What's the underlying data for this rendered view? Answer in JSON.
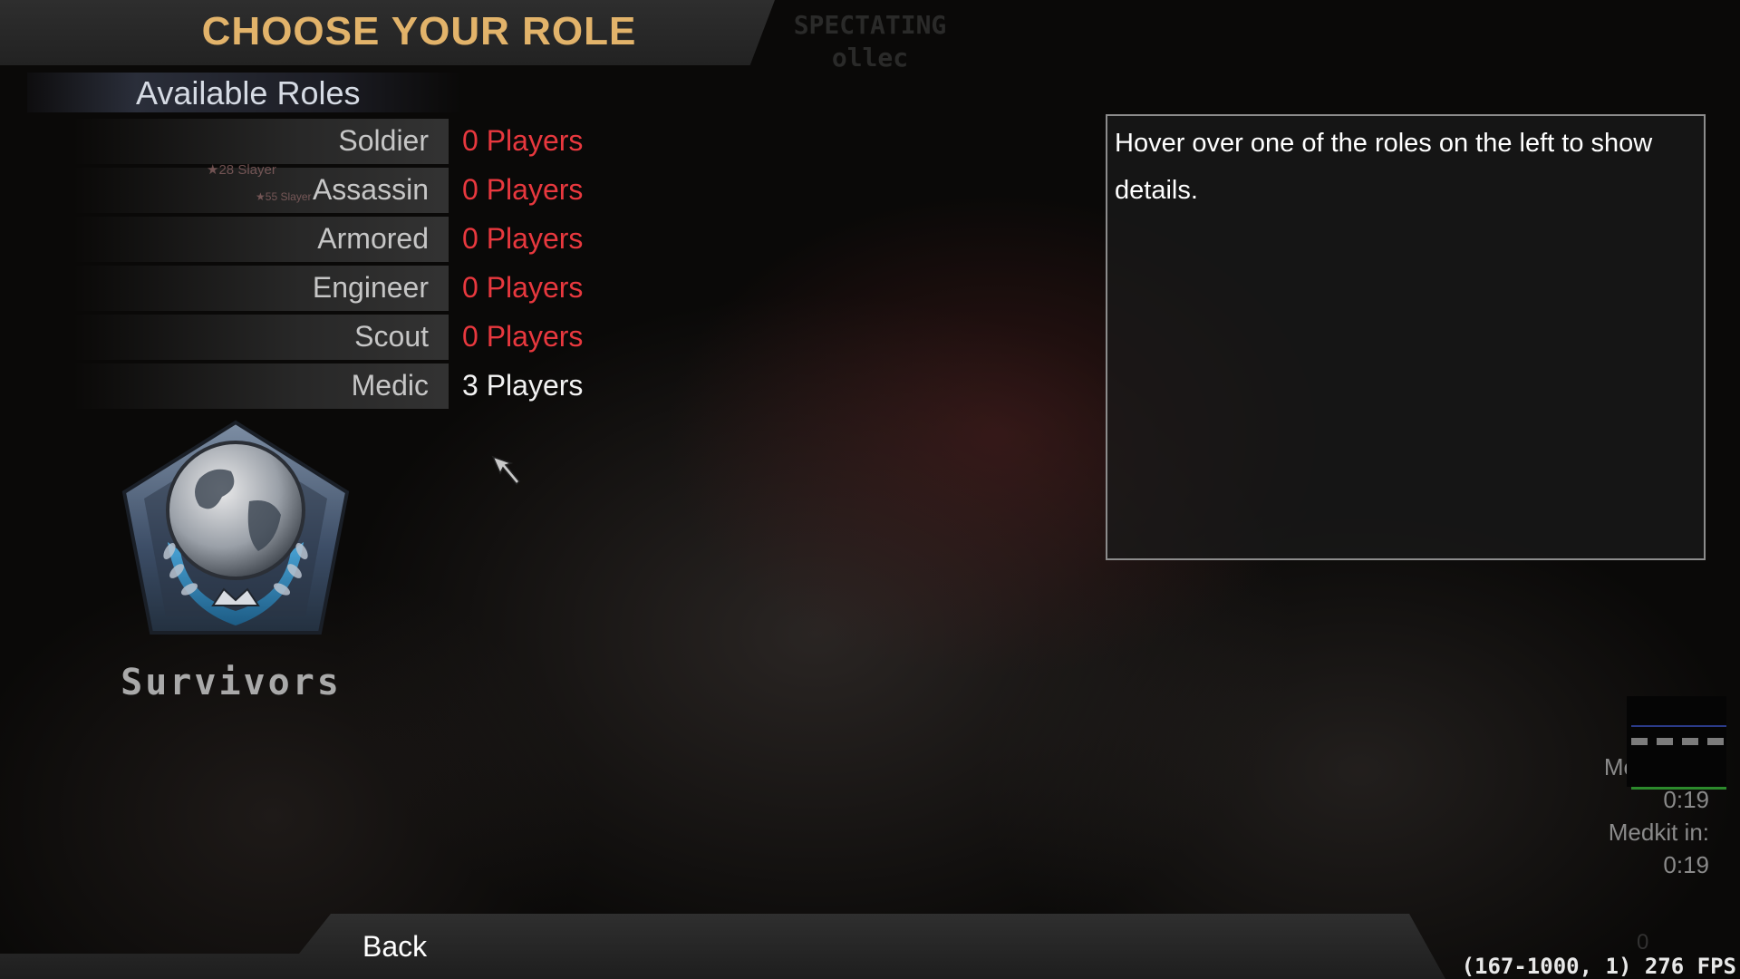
{
  "header": {
    "title": "CHOOSE YOUR ROLE"
  },
  "spectating": {
    "label": "SPECTATING",
    "player": "ollec"
  },
  "roles": {
    "section_title": "Available Roles",
    "items": [
      {
        "name": "Soldier",
        "count": "0 Players"
      },
      {
        "name": "Assassin",
        "count": "0 Players"
      },
      {
        "name": "Armored",
        "count": "0 Players"
      },
      {
        "name": "Engineer",
        "count": "0 Players"
      },
      {
        "name": "Scout",
        "count": "0 Players"
      },
      {
        "name": "Medic",
        "count": "3 Players"
      }
    ]
  },
  "kill_feed": [
    {
      "number": "28",
      "text": "Slayer"
    },
    {
      "number": "55",
      "text": "Slayer"
    }
  ],
  "team": {
    "name": "Survivors"
  },
  "details": {
    "text": "Hover over one of the roles on the left to show details."
  },
  "footer": {
    "back_label": "Back",
    "fps_text": "(167-1000, 1) 276 FPS",
    "faint_text": "0"
  },
  "hud": {
    "partial_label": "Me",
    "partial_time": "0:19",
    "medkit_label": "Medkit in:",
    "medkit_time": "0:19"
  },
  "colors": {
    "title": "#e2b36a",
    "zero_count": "#e8383e",
    "nonzero_count": "#f2f2f2"
  }
}
